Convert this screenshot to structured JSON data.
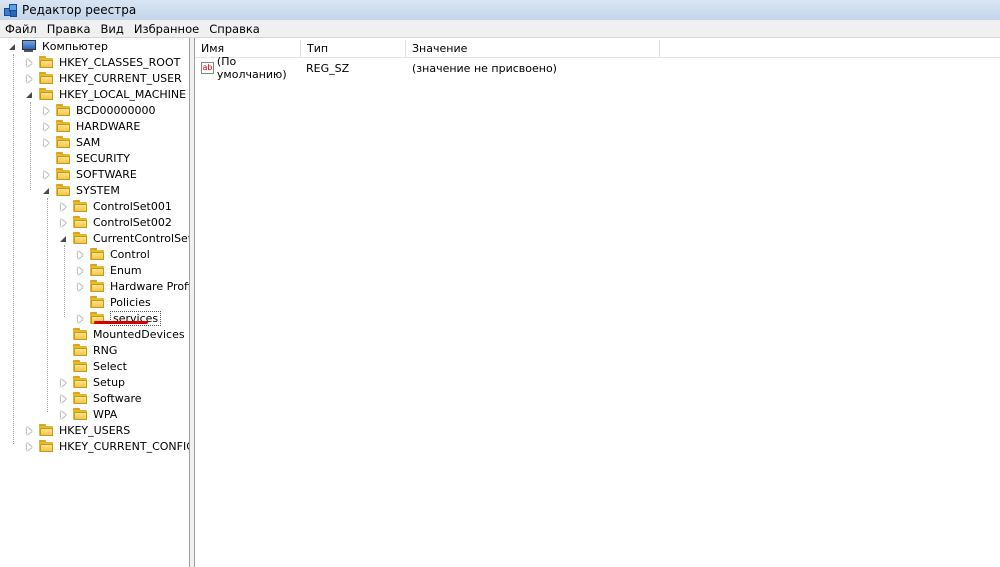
{
  "window": {
    "title": "Редактор реестра"
  },
  "menu": [
    "Файл",
    "Правка",
    "Вид",
    "Избранное",
    "Справка"
  ],
  "tree": {
    "root": "Компьютер",
    "nodes": [
      "HKEY_CLASSES_ROOT",
      "HKEY_CURRENT_USER",
      "HKEY_LOCAL_MACHINE",
      "BCD00000000",
      "HARDWARE",
      "SAM",
      "SECURITY",
      "SOFTWARE",
      "SYSTEM",
      "ControlSet001",
      "ControlSet002",
      "CurrentControlSet",
      "Control",
      "Enum",
      "Hardware Profiles",
      "Policies",
      "services",
      "MountedDevices",
      "RNG",
      "Select",
      "Setup",
      "Software",
      "WPA",
      "HKEY_USERS",
      "HKEY_CURRENT_CONFIG"
    ],
    "selected": "services",
    "highlight_color": "#d40000"
  },
  "list": {
    "columns": [
      "Имя",
      "Тип",
      "Значение"
    ],
    "rows": [
      {
        "name": "(По умолчанию)",
        "type": "REG_SZ",
        "value": "(значение не присвоено)",
        "icon": "ab"
      }
    ]
  }
}
